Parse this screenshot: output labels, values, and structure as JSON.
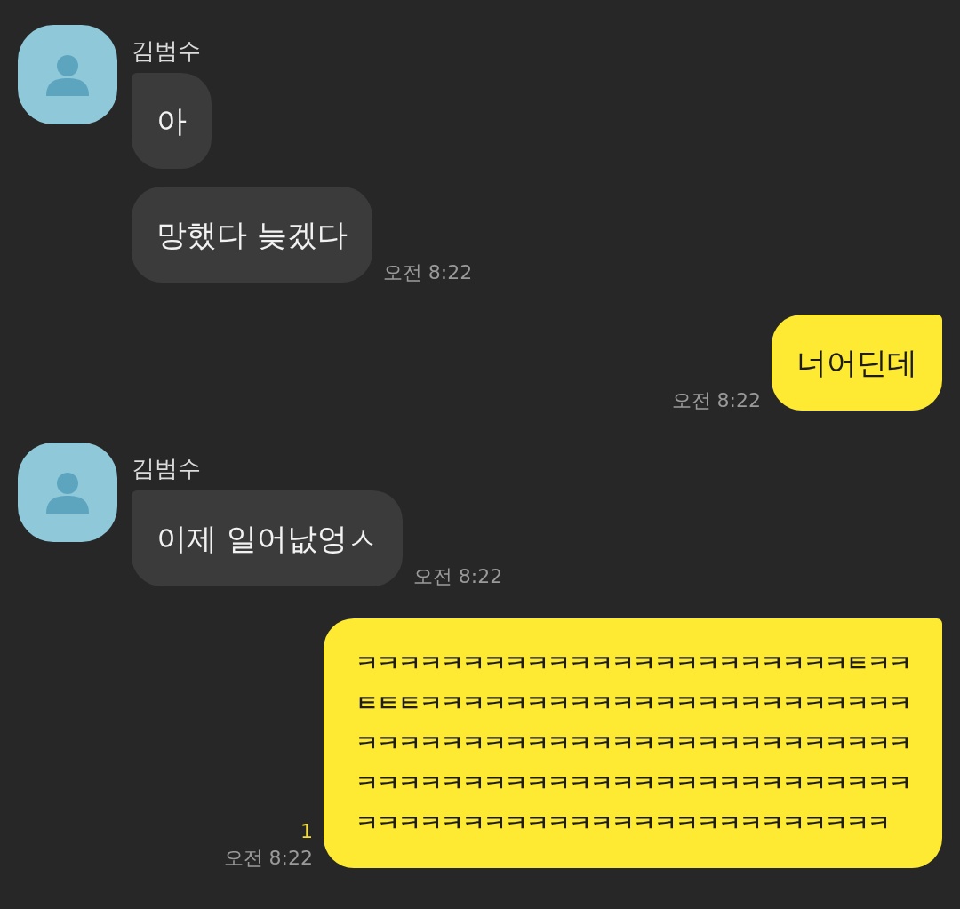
{
  "messages": [
    {
      "kind": "received",
      "sender": "김범수",
      "bubbles": [
        "아",
        "망했다 늦겠다"
      ],
      "time": "오전 8:22"
    },
    {
      "kind": "sent",
      "bubbles": [
        "너어딘데"
      ],
      "time": "오전 8:22"
    },
    {
      "kind": "received",
      "sender": "김범수",
      "bubbles": [
        "이제 일어낪엉ㅅ"
      ],
      "time": "오전 8:22"
    },
    {
      "kind": "sent",
      "lines": [
        "ㅋㅋㅋㅋㅋㅋㅋㅋㅋㅋㅋㅋㅋㅋㅋㅋㅋㅋㅋㅋㅋㅋㅋㅌㅋㅋ",
        "ㅌㅌㅌㅋㅋㅋㅋㅋㅋㅋㅋㅋㅋㅋㅋㅋㅋㅋㅋㅋㅋㅋㅋㅋㅋㅋ",
        "ㅋㅋㅋㅋㅋㅋㅋㅋㅋㅋㅋㅋㅋㅋㅋㅋㅋㅋㅋㅋㅋㅋㅋㅋㅋㅋ",
        "ㅋㅋㅋㅋㅋㅋㅋㅋㅋㅋㅋㅋㅋㅋㅋㅋㅋㅋㅋㅋㅋㅋㅋㅋㅋㅋ",
        "ㅋㅋㅋㅋㅋㅋㅋㅋㅋㅋㅋㅋㅋㅋㅋㅋㅋㅋㅋㅋㅋㅋㅋㅋㅋ"
      ],
      "unread": "1",
      "time": "오전 8:22"
    }
  ]
}
